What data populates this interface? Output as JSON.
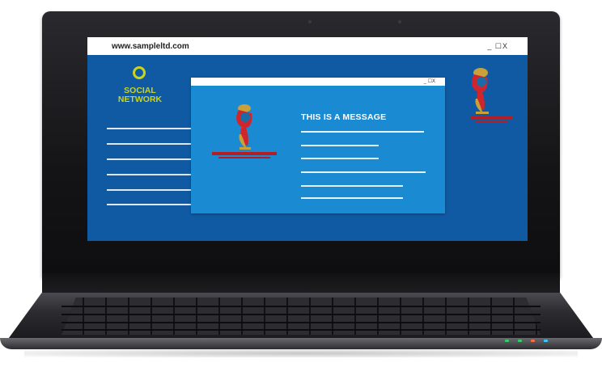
{
  "browser": {
    "url": "www.sampleltd.com",
    "window_controls": "_ ☐X"
  },
  "sidebar": {
    "brand_line1": "SOCIAL",
    "brand_line2": "NETWORK",
    "placeholder_lines": 6
  },
  "dialog": {
    "window_controls": "_ ☐X",
    "message": "THIS IS A MESSAGE",
    "placeholder_lines": 6
  },
  "icons": {
    "logo": "circle-logo-icon",
    "trophy": "world-cup-emblem-icon"
  },
  "colors": {
    "screen_bg": "#0f5aa3",
    "dialog_bg": "#1a8ad2",
    "brand_accent": "#c8d41e",
    "emblem_red": "#d2252b",
    "emblem_gold": "#c9a13b"
  }
}
